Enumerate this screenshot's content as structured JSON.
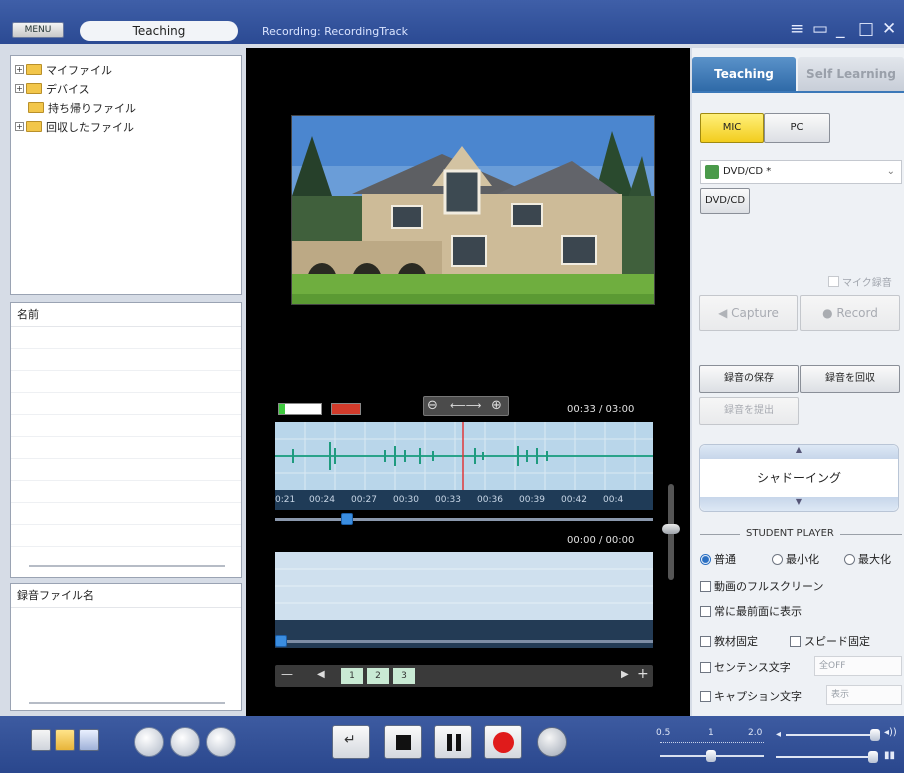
{
  "titlebar": {
    "menu_label": "MENU",
    "mode_label": "Teaching",
    "recording_text": "Recording:  RecordingTrack"
  },
  "folder_tree": {
    "items": [
      {
        "label": "マイファイル",
        "icon": "folder-icon"
      },
      {
        "label": "デバイス",
        "icon": "device-folder-icon"
      },
      {
        "label": "持ち帰りファイル",
        "icon": "takehome-folder-icon"
      },
      {
        "label": "回収したファイル",
        "icon": "collected-folder-icon"
      }
    ]
  },
  "file_list": {
    "header": "名前"
  },
  "recording_files": {
    "header": "録音ファイル名"
  },
  "player": {
    "time_primary": "00:33 / 03:00",
    "time_secondary": "00:00 / 00:00",
    "timeline_ticks": [
      "0:21",
      "00:24",
      "00:27",
      "00:30",
      "00:33",
      "00:36",
      "00:39",
      "00:42",
      "00:4"
    ],
    "pages": [
      "1",
      "2",
      "3"
    ]
  },
  "right_panel": {
    "tab_teaching": "Teaching",
    "tab_self_learning": "Self Learning",
    "mic_label": "MIC",
    "pc_label": "PC",
    "source_selected": "DVD/CD *",
    "dvd_button": "DVD/CD",
    "mic_record_label": "マイク録音",
    "capture_label": "Capture",
    "record_label": "Record",
    "save_recording": "録音の保存",
    "collect_recording": "録音を回収",
    "submit_recording": "録音を提出",
    "mode_display": "シャドーイング",
    "student_player_heading": "STUDENT PLAYER",
    "view_modes": [
      "普通",
      "最小化",
      "最大化"
    ],
    "selected_view_mode": "普通",
    "fullscreen_label": "動画のフルスクリーン",
    "always_on_top_label": "常に最前面に表示",
    "fix_material_label": "教材固定",
    "fix_speed_label": "スピード固定",
    "sentence_label": "センテンス文字",
    "sentence_value": "全OFF",
    "caption_label": "キャプション文字",
    "caption_value": "表示"
  },
  "speed": {
    "min": "0.5",
    "mid": "1",
    "max": "2.0"
  },
  "colors": {
    "titlebar": "#2f4e96",
    "accent_tab": "#3b78b8",
    "record_red": "#e01b1b",
    "mic_yellow": "#f5d52a"
  }
}
